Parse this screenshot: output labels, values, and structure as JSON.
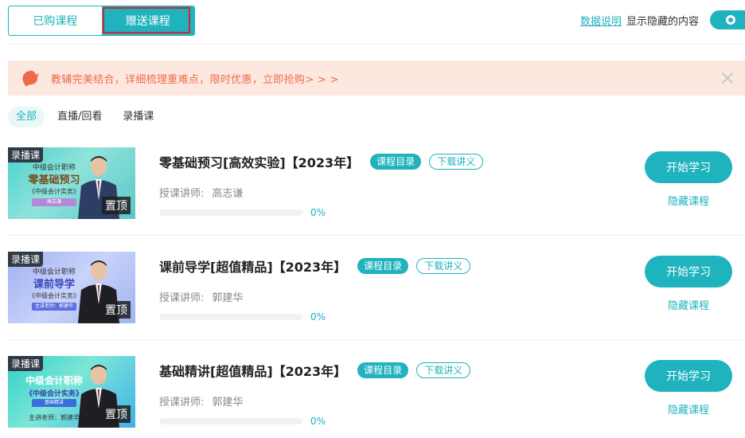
{
  "tabs": [
    {
      "label": "已购课程",
      "active": false
    },
    {
      "label": "赠送课程",
      "active": true
    }
  ],
  "header": {
    "data_info_link": "数据说明",
    "show_hidden_label": "显示隐藏的内容",
    "show_hidden_enabled": true
  },
  "banner": {
    "text": "教辅完美结合，详细梳理重难点，限时优惠，立即抢购> > >",
    "icon": "bell-icon",
    "close_icon": "close-icon"
  },
  "filters": [
    {
      "label": "全部",
      "active": true
    },
    {
      "label": "直播/回看",
      "active": false
    },
    {
      "label": "录播课",
      "active": false
    }
  ],
  "colors": {
    "accent": "#1fb3bd",
    "banner_bg": "#fde8e0",
    "banner_text": "#f06a4a"
  },
  "courses": [
    {
      "badge": "录播课",
      "pin_label": "置顶",
      "thumb_line1": "中级会计职称",
      "thumb_line2": "零基础预习",
      "thumb_line3": "《中级会计实务》",
      "thumb_line4": "高志谦",
      "title": "零基础预习[高效实验]【2023年】",
      "catalog_label": "课程目录",
      "download_label": "下载讲义",
      "teacher_label": "授课讲师:",
      "teacher_name": "高志谦",
      "progress": 0,
      "progress_text": "0%",
      "start_label": "开始学习",
      "hide_label": "隐藏课程"
    },
    {
      "badge": "录播课",
      "pin_label": "置顶",
      "thumb_line1": "中级会计职称",
      "thumb_line2": "课前导学",
      "thumb_line3": "《中级会计实务》",
      "thumb_line4": "主讲老师：郭建华",
      "title": "课前导学[超值精品]【2023年】",
      "catalog_label": "课程目录",
      "download_label": "下载讲义",
      "teacher_label": "授课讲师:",
      "teacher_name": "郭建华",
      "progress": 0,
      "progress_text": "0%",
      "start_label": "开始学习",
      "hide_label": "隐藏课程"
    },
    {
      "badge": "录播课",
      "pin_label": "置顶",
      "thumb_line1": "中级会计职称",
      "thumb_line2": "《中级会计实务》",
      "thumb_line3": "主讲老师：郭建华",
      "thumb_line4": "基础精讲",
      "title": "基础精讲[超值精品]【2023年】",
      "catalog_label": "课程目录",
      "download_label": "下载讲义",
      "teacher_label": "授课讲师:",
      "teacher_name": "郭建华",
      "progress": 0,
      "progress_text": "0%",
      "start_label": "开始学习",
      "hide_label": "隐藏课程"
    }
  ]
}
